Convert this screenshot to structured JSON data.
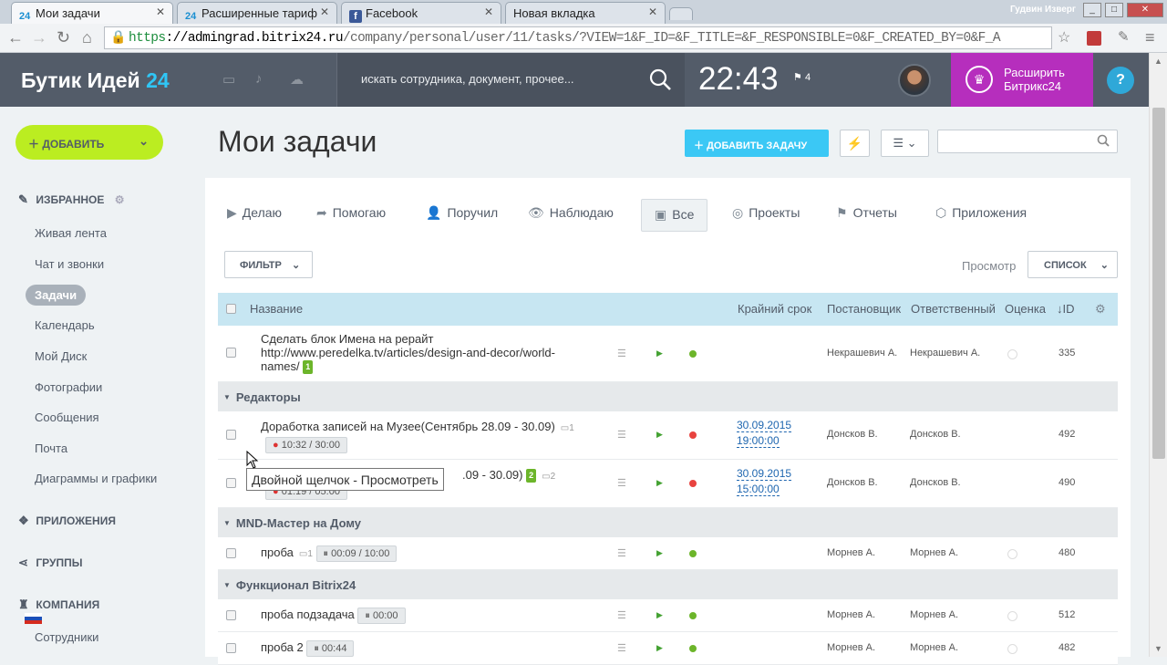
{
  "browser": {
    "tabs": [
      {
        "favicon": "24",
        "label": "Мои задачи",
        "active": true
      },
      {
        "favicon": "24",
        "label": "Расширенные тариф",
        "active": false
      },
      {
        "favicon": "f",
        "label": "Facebook",
        "active": false
      },
      {
        "favicon": "",
        "label": "Новая вкладка",
        "active": false
      }
    ],
    "user": "Гудвин Изверг",
    "url_https": "https",
    "url_host": "://admingrad.bitrix24.ru",
    "url_rest": "/company/personal/user/11/tasks/?VIEW=1&F_ID=&F_TITLE=&F_RESPONSIBLE=0&F_CREATED_BY=0&F_A"
  },
  "header": {
    "logo_text": "Бутик Идей",
    "logo_num": "24",
    "search_placeholder": "искать сотрудника, документ, прочее...",
    "clock": "22:43",
    "flag_count": "4",
    "upgrade_line1": "Расширить",
    "upgrade_line2": "Битрикс24",
    "help": "?"
  },
  "sidebar": {
    "add_button": "ДОБАВИТЬ",
    "favorites": "ИЗБРАННОЕ",
    "items": [
      "Живая лента",
      "Чат и звонки",
      "Задачи",
      "Календарь",
      "Мой Диск",
      "Фотографии",
      "Сообщения",
      "Почта",
      "Диаграммы и графики"
    ],
    "apps": "ПРИЛОЖЕНИЯ",
    "groups": "ГРУППЫ",
    "company": "КОМПАНИЯ",
    "employees": "Сотрудники"
  },
  "page": {
    "title": "Мои задачи",
    "add_task": "ДОБАВИТЬ ЗАДАЧУ",
    "tabs": [
      "Делаю",
      "Помогаю",
      "Поручил",
      "Наблюдаю",
      "Все",
      "Проекты",
      "Отчеты",
      "Приложения"
    ],
    "filter": "ФИЛЬТР",
    "view_label": "Просмотр",
    "view_value": "СПИСОК"
  },
  "grid": {
    "columns": {
      "name": "Название",
      "deadline": "Крайний срок",
      "creator": "Постановщик",
      "responsible": "Ответственный",
      "mark": "Оценка",
      "id": "ID"
    },
    "task0": {
      "line1": "Сделать блок Имена на рерайт",
      "line2": "http://www.peredelka.tv/articles/design-and-decor/world-",
      "line3": "names/",
      "badge": "1",
      "creator": "Некрашевич А.",
      "responsible": "Некрашевич А.",
      "id": "335"
    },
    "group1": "Редакторы",
    "task1": {
      "title": "Доработка записей на Музее(Сентябрь 28.09 - 30.09)",
      "comments": "1",
      "timer": "10:32 / 30:00",
      "deadline_date": "30.09.2015",
      "deadline_time": "19:00:00",
      "creator": "Донсков В.",
      "responsible": "Донсков В.",
      "id": "492"
    },
    "task2": {
      "title_tail": ".09 - 30.09)",
      "badge": "2",
      "comments": "2",
      "timer": "01:19 / 05:00",
      "deadline_date": "30.09.2015",
      "deadline_time": "15:00:00",
      "creator": "Донсков В.",
      "responsible": "Донсков В.",
      "id": "490"
    },
    "group2": "MND-Мастер на Дому",
    "task3": {
      "title": "проба",
      "comments": "1",
      "timer": "00:09 / 10:00",
      "creator": "Морнев А.",
      "responsible": "Морнев А.",
      "id": "480"
    },
    "group3": "Функционал Bitrix24",
    "task4": {
      "title": "проба подзадача",
      "timer": "00:00",
      "creator": "Морнев А.",
      "responsible": "Морнев А.",
      "id": "512"
    },
    "task5": {
      "title": "проба 2",
      "timer": "00:44",
      "creator": "Морнев А.",
      "responsible": "Морнев А.",
      "id": "482"
    }
  },
  "tooltip": "Двойной щелчок - Просмотреть"
}
